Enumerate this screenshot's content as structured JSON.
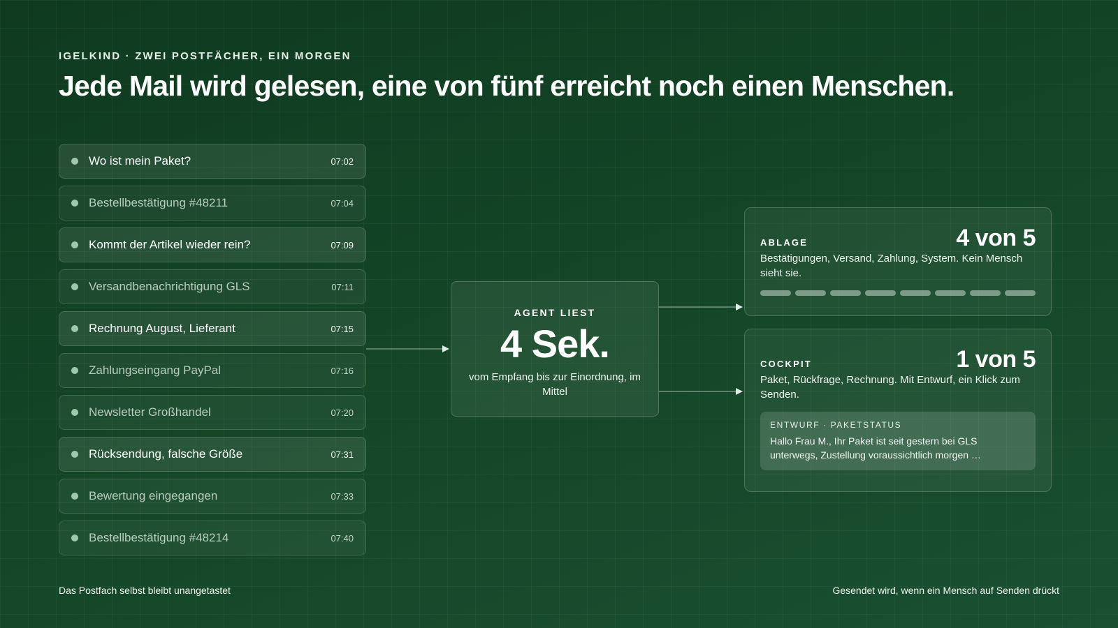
{
  "header": {
    "eyebrow": "IGELKIND · ZWEI POSTFÄCHER, EIN MORGEN",
    "title": "Jede Mail wird gelesen, eine von fünf erreicht noch einen Menschen."
  },
  "mails": [
    {
      "subject": "Wo ist mein Paket?",
      "time": "07:02",
      "kind": "human"
    },
    {
      "subject": "Bestellbestätigung #48211",
      "time": "07:04",
      "kind": "auto"
    },
    {
      "subject": "Kommt der Artikel wieder rein?",
      "time": "07:09",
      "kind": "human"
    },
    {
      "subject": "Versandbenachrichtigung GLS",
      "time": "07:11",
      "kind": "auto"
    },
    {
      "subject": "Rechnung August, Lieferant",
      "time": "07:15",
      "kind": "human"
    },
    {
      "subject": "Zahlungseingang PayPal",
      "time": "07:16",
      "kind": "auto"
    },
    {
      "subject": "Newsletter Großhandel",
      "time": "07:20",
      "kind": "auto"
    },
    {
      "subject": "Rücksendung, falsche Größe",
      "time": "07:31",
      "kind": "human"
    },
    {
      "subject": "Bewertung eingegangen",
      "time": "07:33",
      "kind": "auto"
    },
    {
      "subject": "Bestellbestätigung #48214",
      "time": "07:40",
      "kind": "auto"
    }
  ],
  "agent": {
    "label": "AGENT LIEST",
    "value": "4 Sek.",
    "sub": "vom Empfang bis zur Einordnung, im Mittel"
  },
  "ablage": {
    "name": "ABLAGE",
    "count": "4 von 5",
    "desc": "Bestätigungen, Versand, Zahlung, System. Kein Mensch sieht sie.",
    "bar_count": 8
  },
  "cockpit": {
    "name": "COCKPIT",
    "count": "1 von 5",
    "desc": "Paket, Rückfrage, Rechnung. Mit Entwurf, ein Klick zum Senden.",
    "draft_label": "ENTWURF · PAKETSTATUS",
    "draft_text": "Hallo Frau M., Ihr Paket ist seit gestern bei GLS unterwegs, Zustellung voraussichtlich morgen …"
  },
  "footer": {
    "left": "Das Postfach selbst bleibt unangetastet",
    "right": "Gesendet wird, wenn ein Mensch auf Senden drückt"
  },
  "colors": {
    "background": "#123f24",
    "dot": "#9fc9ac",
    "connector": "#cfd9d2"
  }
}
